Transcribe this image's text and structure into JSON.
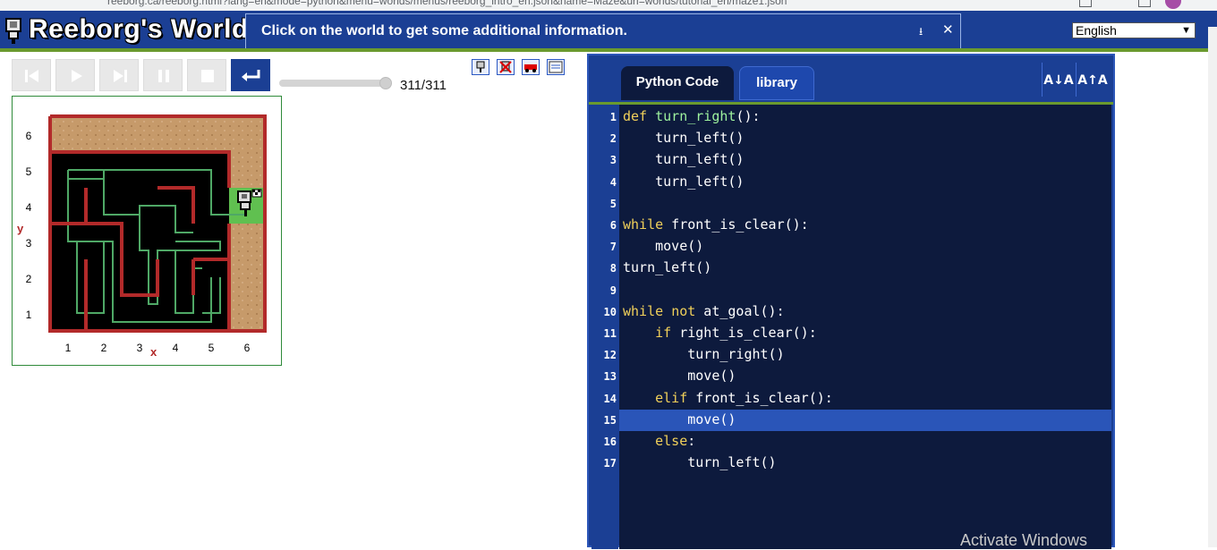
{
  "browser": {
    "url": "reeborg.ca/reeborg.html?lang=en&mode=python&menu=worlds/menus/reeborg_intro_en.json&name=Maze&url=worlds/tutorial_en/maze1.json"
  },
  "header": {
    "app_title": "Reeborg's World",
    "info_message": "Click on the world to get some additional information.",
    "download_icon": "download-icon",
    "close_icon": "close-icon",
    "language": "English"
  },
  "controls": {
    "buttons": [
      "reload",
      "run",
      "step",
      "pause",
      "stop",
      "return"
    ],
    "step_counter": "311/311",
    "slider_fraction": 1.0,
    "toolbar_icons": [
      "robot-icon",
      "robot-remove-icon",
      "car-icon",
      "world-edit-icon"
    ]
  },
  "world": {
    "x_axis_label": "x",
    "y_axis_label": "y",
    "x_ticks": [
      "1",
      "2",
      "3",
      "4",
      "5",
      "6"
    ],
    "y_ticks": [
      "6",
      "5",
      "4",
      "3",
      "2",
      "1"
    ]
  },
  "editor": {
    "tabs": [
      "Python Code",
      "library"
    ],
    "font_buttons": [
      "A↓A",
      "A↑A"
    ],
    "highlighted_line": 15,
    "lines": [
      {
        "n": "1",
        "text": "def turn_right():"
      },
      {
        "n": "2",
        "text": "    turn_left()"
      },
      {
        "n": "3",
        "text": "    turn_left()"
      },
      {
        "n": "4",
        "text": "    turn_left()"
      },
      {
        "n": "5",
        "text": ""
      },
      {
        "n": "6",
        "text": "while front_is_clear():"
      },
      {
        "n": "7",
        "text": "    move()"
      },
      {
        "n": "8",
        "text": "turn_left()"
      },
      {
        "n": "9",
        "text": ""
      },
      {
        "n": "10",
        "text": "while not at_goal():"
      },
      {
        "n": "11",
        "text": "    if right_is_clear():"
      },
      {
        "n": "12",
        "text": "        turn_right()"
      },
      {
        "n": "13",
        "text": "        move()"
      },
      {
        "n": "14",
        "text": "    elif front_is_clear():"
      },
      {
        "n": "15",
        "text": "        move()"
      },
      {
        "n": "16",
        "text": "    else:"
      },
      {
        "n": "17",
        "text": "        turn_left()"
      }
    ]
  },
  "watermark": "Activate Windows"
}
